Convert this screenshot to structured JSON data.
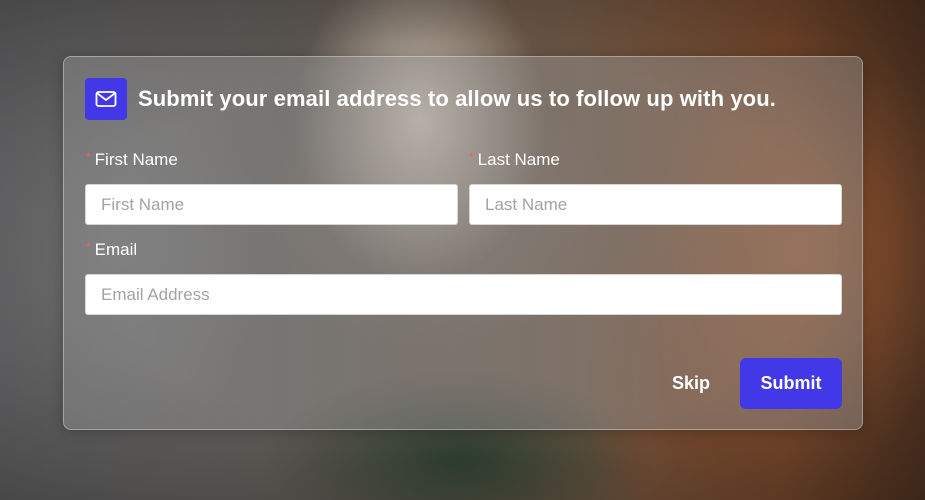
{
  "dialog": {
    "title": "Submit your email address to allow us to follow up with you.",
    "icon": "mail-icon",
    "accent_color": "#4338e8",
    "required_marker": "*",
    "required_color": "#ff5a5a"
  },
  "form": {
    "first_name": {
      "label": "First Name",
      "value": "",
      "placeholder": "First Name"
    },
    "last_name": {
      "label": "Last Name",
      "value": "",
      "placeholder": "Last Name"
    },
    "email": {
      "label": "Email",
      "value": "",
      "placeholder": "Email Address"
    }
  },
  "actions": {
    "skip_label": "Skip",
    "submit_label": "Submit"
  }
}
